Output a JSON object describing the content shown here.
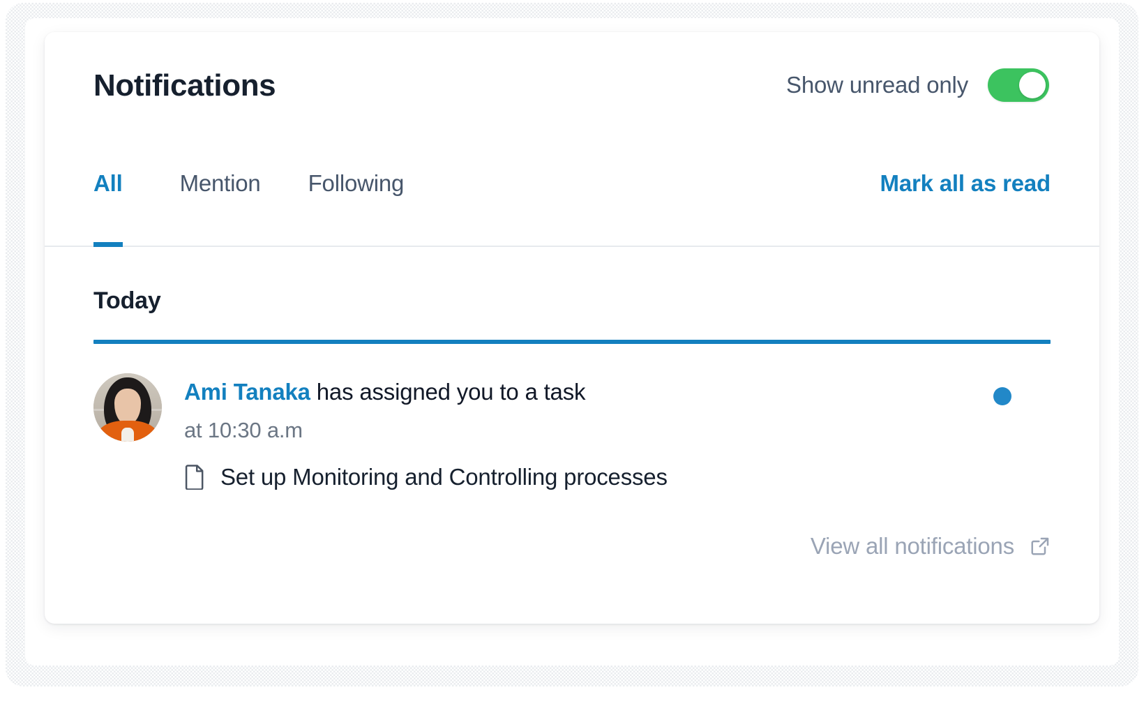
{
  "header": {
    "title": "Notifications",
    "unread_toggle_label": "Show unread only",
    "unread_toggle_state": "on",
    "toggle_color": "#3cc35f"
  },
  "tabs": {
    "items": [
      {
        "label": "All",
        "active": true
      },
      {
        "label": "Mention",
        "active": false
      },
      {
        "label": "Following",
        "active": false
      }
    ],
    "mark_all_label": "Mark all as read",
    "accent_color": "#1380bf"
  },
  "body": {
    "group_title": "Today",
    "notification": {
      "actor": "Ami Tanaka",
      "action": " has assigned you to a task",
      "time": "at 10:30 a.m",
      "task_title": "Set up Monitoring and Controlling processes",
      "task_icon": "document-icon",
      "unread": true,
      "unread_dot_color": "#2288c8"
    }
  },
  "footer": {
    "view_all_label": "View all notifications",
    "view_all_icon": "external-link-icon"
  }
}
